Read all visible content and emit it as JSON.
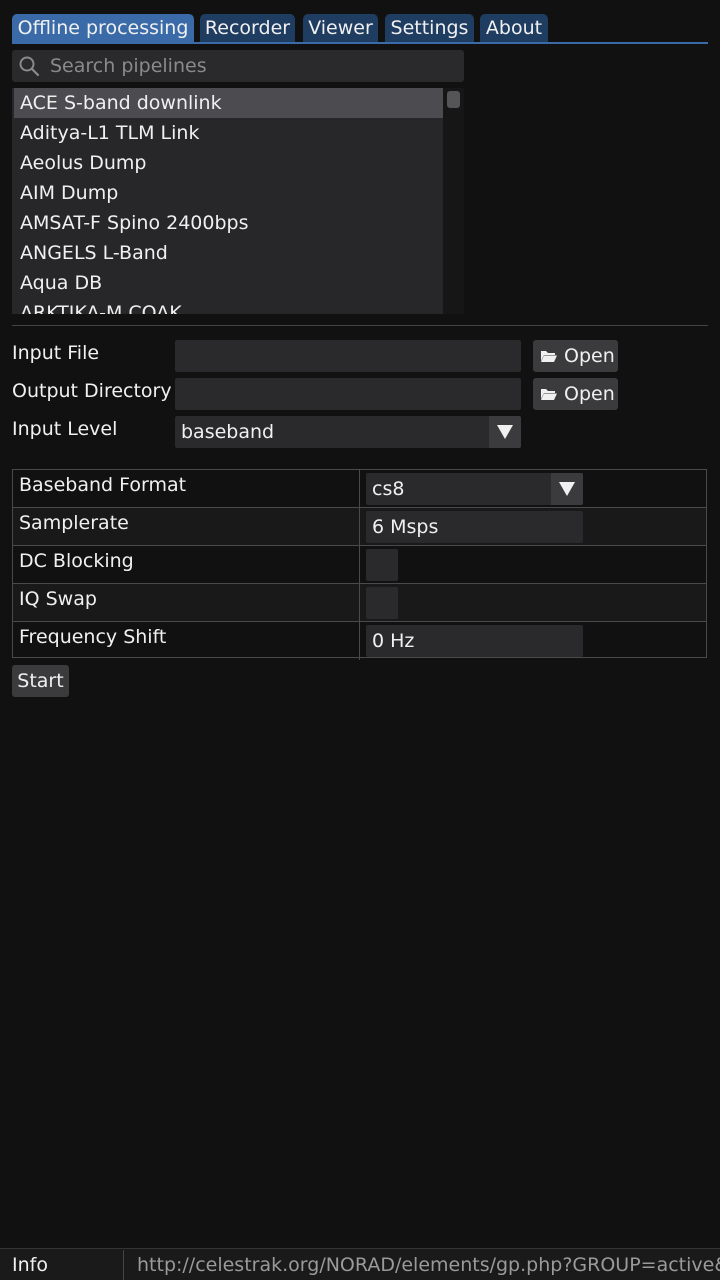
{
  "tabs": [
    {
      "label": "Offline processing",
      "active": true
    },
    {
      "label": "Recorder",
      "active": false
    },
    {
      "label": "Viewer",
      "active": false
    },
    {
      "label": "Settings",
      "active": false
    },
    {
      "label": "About",
      "active": false
    }
  ],
  "search": {
    "placeholder": "Search pipelines",
    "value": "",
    "icon": "search-icon"
  },
  "pipelines": {
    "items": [
      "ACE S-band downlink",
      "Aditya-L1 TLM Link",
      "Aeolus Dump",
      "AIM Dump",
      "AMSAT-F Spino 2400bps",
      "ANGELS L-Band",
      "Aqua DB",
      "ARKTIKA-M COAK"
    ],
    "selected_index": 0
  },
  "form": {
    "input_file": {
      "label": "Input File",
      "value": "",
      "button": "Open"
    },
    "output_dir": {
      "label": "Output Directory",
      "value": "",
      "button": "Open"
    },
    "input_level": {
      "label": "Input Level",
      "value": "baseband"
    }
  },
  "settings": {
    "baseband_format": {
      "label": "Baseband Format",
      "value": "cs8"
    },
    "samplerate": {
      "label": "Samplerate",
      "value": "6 Msps"
    },
    "dc_blocking": {
      "label": "DC Blocking",
      "checked": false
    },
    "iq_swap": {
      "label": "IQ Swap",
      "checked": false
    },
    "frequency_shift": {
      "label": "Frequency Shift",
      "value": "0 Hz"
    }
  },
  "actions": {
    "start_label": "Start"
  },
  "status": {
    "info_label": "Info",
    "message": "http://celestrak.org/NORAD/elements/gp.php?GROUP=active&FORMAT=tle"
  },
  "colors": {
    "background": "#111111",
    "tab_active": "#3a6ba8",
    "tab_inactive": "#1f3c61",
    "frame": "#2a2a2d",
    "button": "#3b3b3e"
  }
}
